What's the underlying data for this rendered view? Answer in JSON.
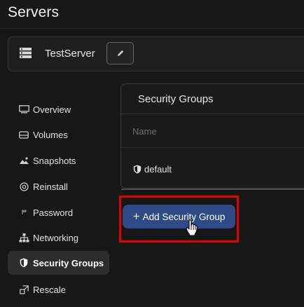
{
  "page": {
    "title": "Servers"
  },
  "server": {
    "name": "TestServer",
    "icon": "server-icon",
    "edit_icon": "pencil-icon"
  },
  "sidebar": {
    "items": [
      {
        "label": "Overview",
        "icon": "monitor-icon",
        "active": false
      },
      {
        "label": "Volumes",
        "icon": "drive-icon",
        "active": false
      },
      {
        "label": "Snapshots",
        "icon": "snapshot-icon",
        "active": false
      },
      {
        "label": "Reinstall",
        "icon": "reinstall-icon",
        "active": false
      },
      {
        "label": "Password",
        "icon": "password-icon",
        "active": false
      },
      {
        "label": "Networking",
        "icon": "network-icon",
        "active": false
      },
      {
        "label": "Security Groups",
        "icon": "shield-icon",
        "active": true
      },
      {
        "label": "Rescale",
        "icon": "rescale-icon",
        "active": false
      }
    ]
  },
  "security_groups": {
    "title": "Security Groups",
    "column_name": "Name",
    "rows": [
      {
        "name": "default",
        "icon": "shield-icon"
      }
    ]
  },
  "actions": {
    "add_label": "Add Security Group",
    "add_icon": "plus-icon"
  },
  "colors": {
    "background": "#171717",
    "primary_button": "#2f4a86",
    "highlight": "#e00000",
    "active_nav": "#2d2d2d"
  }
}
